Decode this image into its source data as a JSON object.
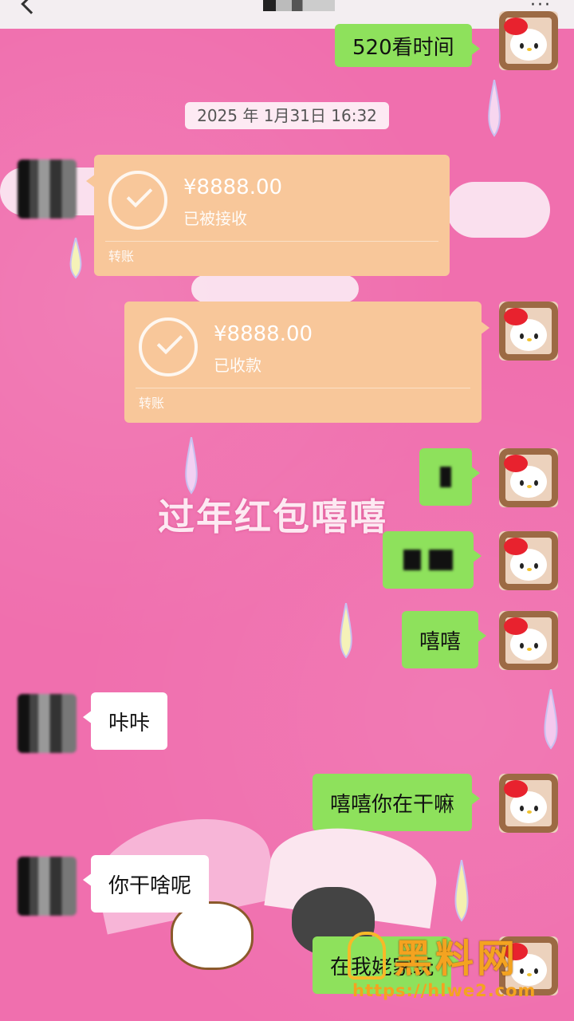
{
  "topbar": {
    "more_icon": "more-icon",
    "back_icon": "back-icon"
  },
  "timestamp": "2025 年 1月31日 16:32",
  "messages": {
    "m0": "520看时间",
    "t1": {
      "amount": "¥8888.00",
      "status": "已被接收",
      "label": "转账"
    },
    "t2": {
      "amount": "¥8888.00",
      "status": "已收款",
      "label": "转账"
    },
    "m3": "嘻嘻",
    "m4": "咔咔",
    "m5": "嘻嘻你在干嘛",
    "m6": "你干啥呢",
    "m7": "在我姥家玩"
  },
  "overlay_caption": "过年红包嘻嘻",
  "watermark": {
    "title": "黑料网",
    "url": "https://hlwe2.com"
  },
  "colors": {
    "wallpaper": "#f06fae",
    "bubble_green": "#8ee15c",
    "bubble_white": "#ffffff",
    "transfer": "#f8c79a",
    "watermark": "#f4a320"
  }
}
